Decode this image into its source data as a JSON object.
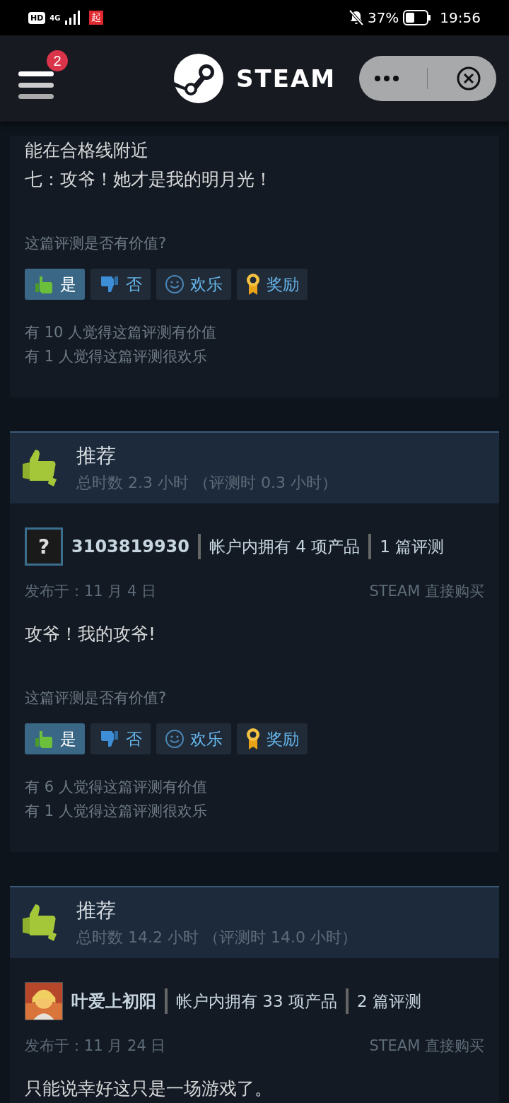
{
  "status_bar": {
    "hd": "HD",
    "network": "4G",
    "app_badge": "起",
    "battery": "37%",
    "time": "19:56"
  },
  "header": {
    "menu_badge": "2",
    "logo": "STEAM"
  },
  "partial_review": {
    "lines": [
      "能在合格线附近",
      "七：攻爷！她才是我的明月光！"
    ],
    "helpful_prompt": "这篇评测是否有价值?",
    "buttons": [
      {
        "kind": "yes",
        "label": "是",
        "selected": true
      },
      {
        "kind": "no",
        "label": "否",
        "selected": false
      },
      {
        "kind": "funny",
        "label": "欢乐",
        "selected": false
      },
      {
        "kind": "award",
        "label": "奖励",
        "selected": false
      }
    ],
    "stats": [
      "有 10 人觉得这篇评测有价值",
      "有 1 人觉得这篇评测很欢乐"
    ]
  },
  "reviews": [
    {
      "verdict": "推荐",
      "hours": "总时数 2.3 小时 （评测时 0.3 小时）",
      "avatar": {
        "kind": "unknown",
        "label": "?"
      },
      "author": "3103819930",
      "products": "帐户内拥有 4 项产品",
      "review_count": "1 篇评测",
      "posted": "发布于：11 月 4 日",
      "source": "STEAM 直接购买",
      "body": "攻爷！我的攻爷!",
      "helpful_prompt": "这篇评测是否有价值?",
      "buttons": [
        {
          "kind": "yes",
          "label": "是",
          "selected": true
        },
        {
          "kind": "no",
          "label": "否",
          "selected": false
        },
        {
          "kind": "funny",
          "label": "欢乐",
          "selected": false
        },
        {
          "kind": "award",
          "label": "奖励",
          "selected": false
        }
      ],
      "stats": [
        "有 6 人觉得这篇评测有价值",
        "有 1 人觉得这篇评测很欢乐"
      ]
    },
    {
      "verdict": "推荐",
      "hours": "总时数 14.2 小时 （评测时 14.0 小时）",
      "author": "叶爱上初阳",
      "products": "帐户内拥有 33 项产品",
      "review_count": "2 篇评测",
      "posted": "发布于：11 月 24 日",
      "source": "STEAM 直接购买",
      "body": "只能说幸好这只是一场游戏了。"
    }
  ]
}
